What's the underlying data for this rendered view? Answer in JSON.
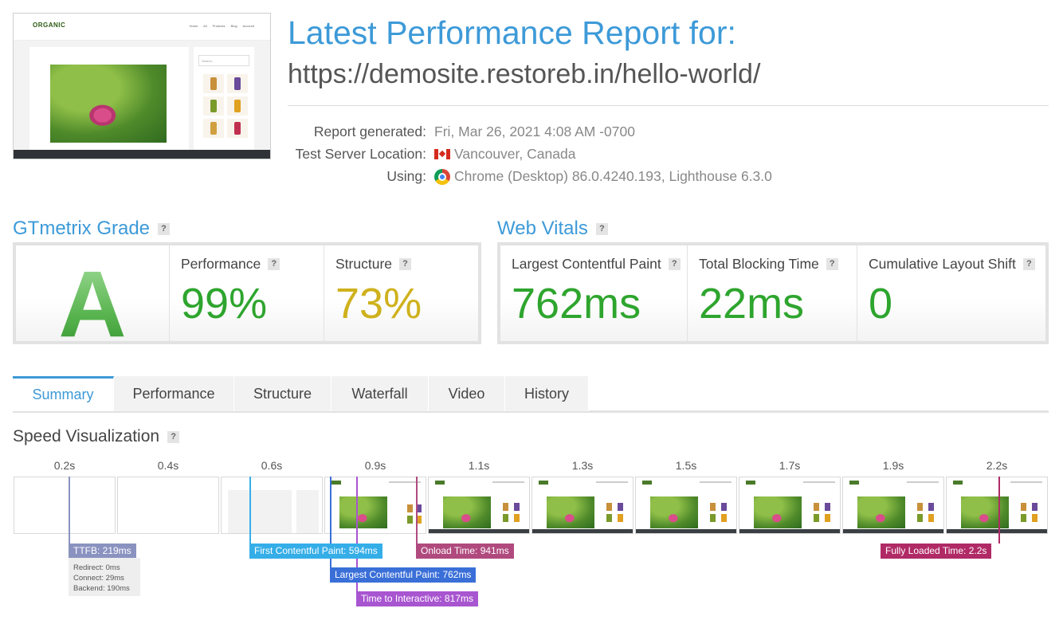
{
  "header": {
    "title": "Latest Performance Report for:",
    "url": "https://demosite.restoreb.in/hello-world/",
    "report_generated_label": "Report generated:",
    "report_generated_value": "Fri, Mar 26, 2021 4:08 AM -0700",
    "server_label": "Test Server Location:",
    "server_value": "Vancouver, Canada",
    "server_flag_icon": "canada-flag-icon",
    "using_label": "Using:",
    "using_value": "Chrome (Desktop) 86.0.4240.193, Lighthouse 6.3.0",
    "using_icon": "chrome-icon"
  },
  "thumbnail": {
    "logo": "ORGANIC",
    "nav": "Home All Products Blog Account",
    "search_placeholder": "Search..."
  },
  "gtmetrix": {
    "heading": "GTmetrix Grade",
    "help": "?",
    "grade": "A",
    "performance_label": "Performance",
    "performance_value": "99%",
    "structure_label": "Structure",
    "structure_value": "73%",
    "colors": {
      "grade": "#4caf50",
      "performance": "#2ea52e",
      "structure": "#cfb11c"
    }
  },
  "web_vitals": {
    "heading": "Web Vitals",
    "help": "?",
    "lcp_label": "Largest Contentful Paint",
    "lcp_value": "762ms",
    "tbt_label": "Total Blocking Time",
    "tbt_value": "22ms",
    "cls_label": "Cumulative Layout Shift",
    "cls_value": "0",
    "colors": {
      "good": "#2ea52e"
    }
  },
  "tabs": [
    {
      "label": "Summary",
      "active": true
    },
    {
      "label": "Performance",
      "active": false
    },
    {
      "label": "Structure",
      "active": false
    },
    {
      "label": "Waterfall",
      "active": false
    },
    {
      "label": "Video",
      "active": false
    },
    {
      "label": "History",
      "active": false
    }
  ],
  "speed_visualization": {
    "heading": "Speed Visualization",
    "help": "?",
    "frame_times": [
      "0.2s",
      "0.4s",
      "0.6s",
      "0.9s",
      "1.1s",
      "1.3s",
      "1.5s",
      "1.7s",
      "1.9s",
      "2.2s"
    ],
    "markers": {
      "ttfb": "TTFB: 219ms",
      "fcp": "First Contentful Paint: 594ms",
      "lcp": "Largest Contentful Paint: 762ms",
      "tti": "Time to Interactive: 817ms",
      "onload": "Onload Time: 941ms",
      "fully_loaded": "Fully Loaded Time: 2.2s"
    },
    "ttfb_details": {
      "redirect": "Redirect: 0ms",
      "connect": "Connect: 29ms",
      "backend": "Backend: 190ms"
    },
    "marker_colors": {
      "ttfb": "#8a93c0",
      "fcp": "#35aee8",
      "lcp": "#3a6fd8",
      "tti": "#a855d0",
      "onload": "#b04a7e",
      "fully_loaded": "#b02a66"
    }
  }
}
